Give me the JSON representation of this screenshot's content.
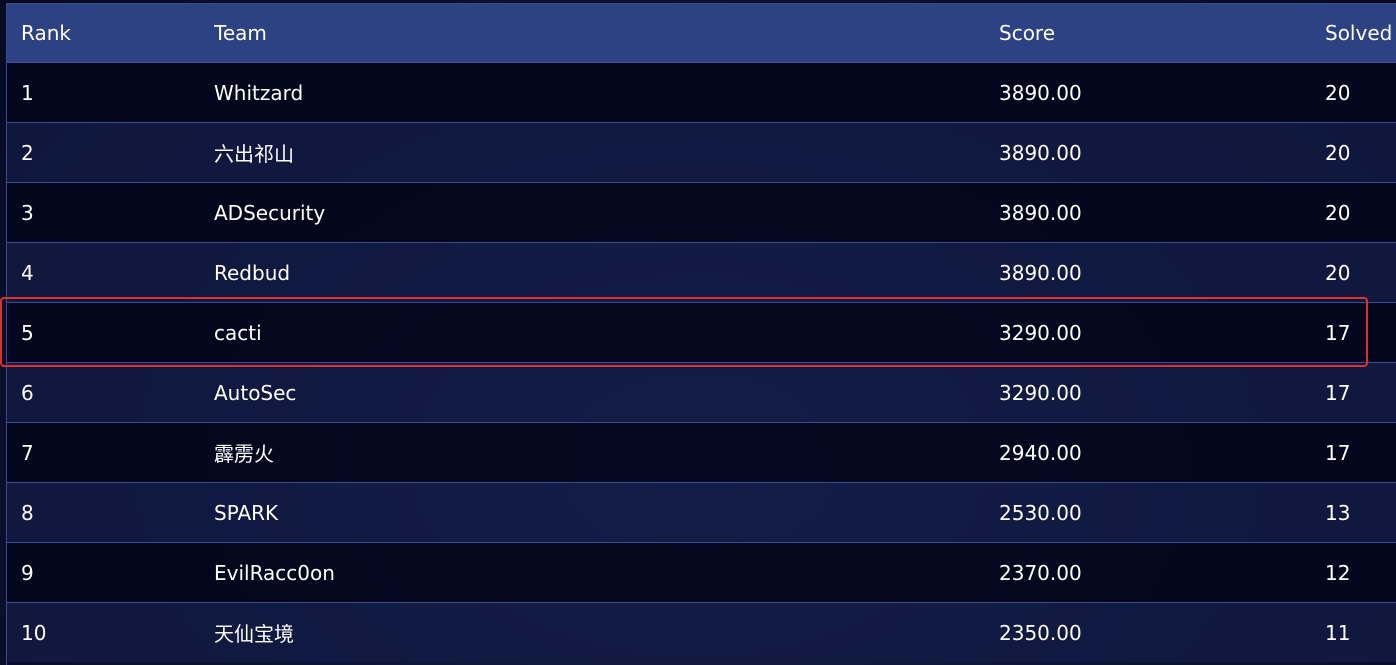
{
  "scoreboard": {
    "columns": {
      "rank": "Rank",
      "team": "Team",
      "score": "Score",
      "solved": "Solved"
    },
    "rows": [
      {
        "rank": "1",
        "team": "Whitzard",
        "score": "3890.00",
        "solved": "20"
      },
      {
        "rank": "2",
        "team": "六出祁山",
        "score": "3890.00",
        "solved": "20"
      },
      {
        "rank": "3",
        "team": "ADSecurity",
        "score": "3890.00",
        "solved": "20"
      },
      {
        "rank": "4",
        "team": "Redbud",
        "score": "3890.00",
        "solved": "20"
      },
      {
        "rank": "5",
        "team": "cacti",
        "score": "3290.00",
        "solved": "17"
      },
      {
        "rank": "6",
        "team": "AutoSec",
        "score": "3290.00",
        "solved": "17"
      },
      {
        "rank": "7",
        "team": "霹雳火",
        "score": "2940.00",
        "solved": "17"
      },
      {
        "rank": "8",
        "team": "SPARK",
        "score": "2530.00",
        "solved": "13"
      },
      {
        "rank": "9",
        "team": "EvilRacc0on",
        "score": "2370.00",
        "solved": "12"
      },
      {
        "rank": "10",
        "team": "天仙宝境",
        "score": "2350.00",
        "solved": "11"
      }
    ],
    "highlighted_rank": "5"
  },
  "colors": {
    "header_bg": "#2d4283",
    "row_dark": "#03061c",
    "row_light": "#121b44",
    "divider": "#3b4d94",
    "highlight_border": "#e0302c",
    "text": "#ffffff"
  }
}
